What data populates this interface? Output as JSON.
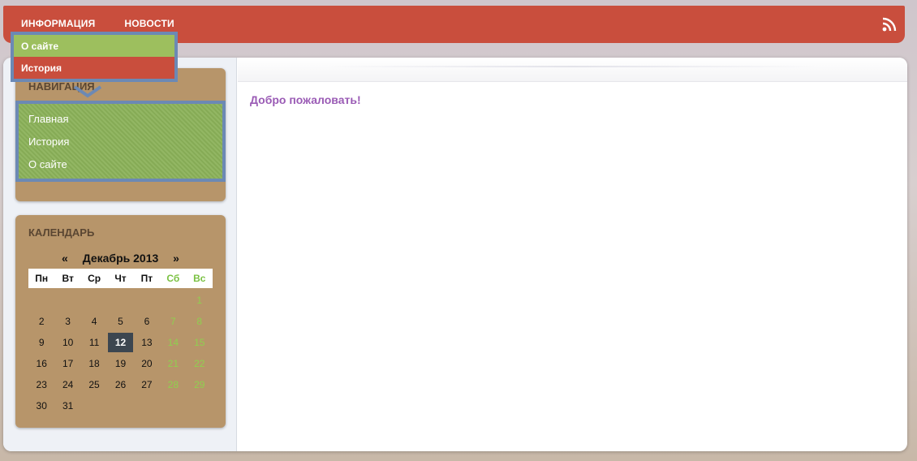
{
  "topnav": {
    "items": [
      "ИНФОРМАЦИЯ",
      "НОВОСТИ"
    ],
    "rss_icon": "rss-icon"
  },
  "dropdown": {
    "items": [
      "О сайте",
      "История"
    ]
  },
  "navigation": {
    "title": "НАВИГАЦИЯ",
    "items": [
      "Главная",
      "История",
      "О сайте"
    ]
  },
  "content": {
    "welcome": "Добро пожаловать!"
  },
  "calendar": {
    "title": "КАЛЕНДАРЬ",
    "prev": "«",
    "next": "»",
    "month": "Декабрь 2013",
    "weekdays": [
      "Пн",
      "Вт",
      "Ср",
      "Чт",
      "Пт",
      "Сб",
      "Вс"
    ],
    "first_weekday_index": 6,
    "days": 31,
    "today": 12
  },
  "colors": {
    "topbar": "#c94e3d",
    "panel": "#b7956a",
    "nav_green": "#8bb259",
    "highlight_border": "#6c89b4",
    "welcome": "#9a5bb5",
    "weekend": "#7ac142"
  }
}
